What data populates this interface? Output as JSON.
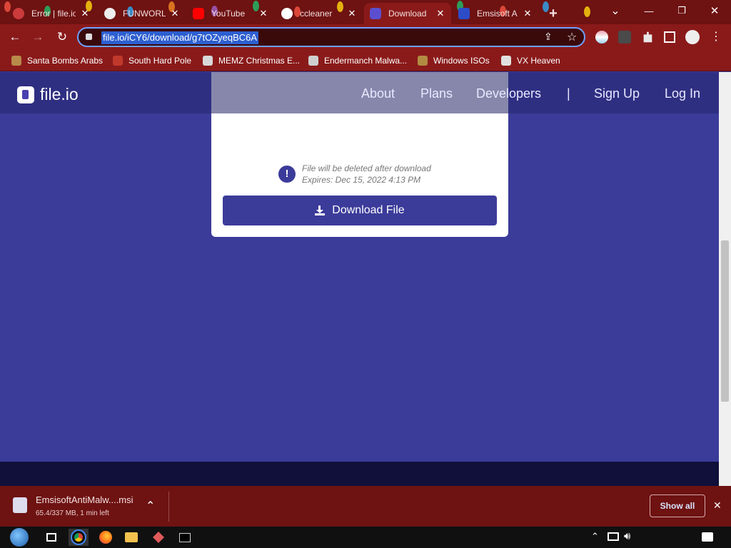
{
  "browser": {
    "tabs": [
      {
        "title": "Error | file.io",
        "fav": "#cc3b3b"
      },
      {
        "title": "FUNWORLD",
        "fav": "#eeeeee"
      },
      {
        "title": "YouTube",
        "fav": "#ff0000"
      },
      {
        "title": "ccleaner",
        "fav": "#ffffff"
      },
      {
        "title": "Download",
        "fav": "#5b4fcf"
      },
      {
        "title": "Emsisoft A",
        "fav": "#2d4cc8"
      }
    ],
    "tab_close": "✕",
    "new_tab": "+",
    "url": "file.io/iCY6/download/g7tOZyeqBC6A",
    "bookmarks": [
      {
        "label": "Santa Bombs Arabs",
        "color": "#b98a4a"
      },
      {
        "label": "South Hard Pole",
        "color": "#c0392b"
      },
      {
        "label": "MEMZ Christmas E...",
        "color": "#d8d8d8"
      },
      {
        "label": "Endermanch Malwa...",
        "color": "#cfcfcf"
      },
      {
        "label": "Windows ISOs",
        "color": "#b28b42"
      },
      {
        "label": "VX Heaven",
        "color": "#e0e0e0"
      }
    ],
    "icons": {
      "back": "←",
      "forward": "→",
      "reload": "↻",
      "share": "⇪",
      "star": "☆",
      "menu": "⋮",
      "min": "—",
      "restore": "❐",
      "close": "✕",
      "chevron": "⌄"
    }
  },
  "site": {
    "logo": "file.io",
    "nav": [
      "About",
      "Plans",
      "Developers",
      "|",
      "Sign Up",
      "Log In"
    ],
    "note_line1": "File will be deleted after download",
    "note_line2": "Expires: Dec 15, 2022 4:13 PM",
    "download_label": "Download File"
  },
  "download_shelf": {
    "filename": "EmsisoftAntiMalw....msi",
    "status": "65.4/337 MB, 1 min left",
    "show_all": "Show all",
    "close": "✕",
    "expand": "⌃"
  }
}
